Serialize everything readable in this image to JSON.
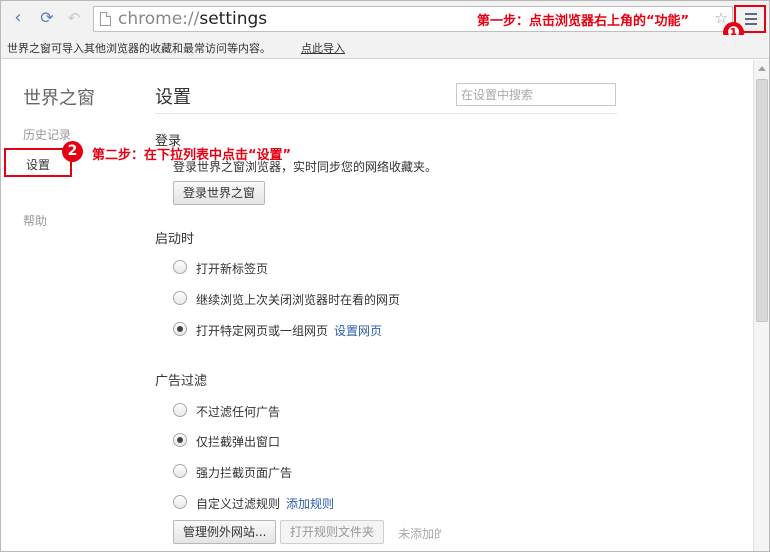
{
  "browser": {
    "url_scheme": "chrome://",
    "url_path": "settings",
    "menu_icon": "hamburger-menu-icon",
    "star_icon": "bookmark-star-icon"
  },
  "annotations": {
    "step1": "第一步：点击浏览器右上角的“功能”",
    "step1_badge": "❶",
    "step2": "第二步：在下拉列表中点击“设置”",
    "step2_badge": "2"
  },
  "infobar": {
    "text": "世界之窗可导入其他浏览器的收藏和最常访问等内容。",
    "link": "点此导入"
  },
  "sidebar": {
    "app_title": "世界之窗",
    "items": [
      {
        "label": "历史记录"
      },
      {
        "label": "设置"
      },
      {
        "label": "帮助"
      }
    ]
  },
  "main": {
    "title": "设置",
    "search_placeholder": "在设置中搜索",
    "login": {
      "title": "登录",
      "description": "登录世界之窗浏览器，实时同步您的网络收藏夹。",
      "button": "登录世界之窗"
    },
    "startup": {
      "title": "启动时",
      "options": [
        {
          "label": "打开新标签页",
          "checked": false
        },
        {
          "label": "继续浏览上次关闭浏览器时在看的网页",
          "checked": false
        },
        {
          "label": "打开特定网页或一组网页",
          "checked": true,
          "link": "设置网页"
        }
      ]
    },
    "adblock": {
      "title": "广告过滤",
      "options": [
        {
          "label": "不过滤任何广告",
          "checked": false
        },
        {
          "label": "仅拦截弹出窗口",
          "checked": true
        },
        {
          "label": "强力拦截页面广告",
          "checked": false
        },
        {
          "label": "自定义过滤规则",
          "checked": false,
          "link": "添加规则"
        }
      ],
      "manage_button": "管理例外网站...",
      "open_rules_button": "打开规则文件夹",
      "status": "未添加的"
    }
  },
  "colors": {
    "annotation_red": "#e60012",
    "link_blue": "#2a5db0"
  }
}
